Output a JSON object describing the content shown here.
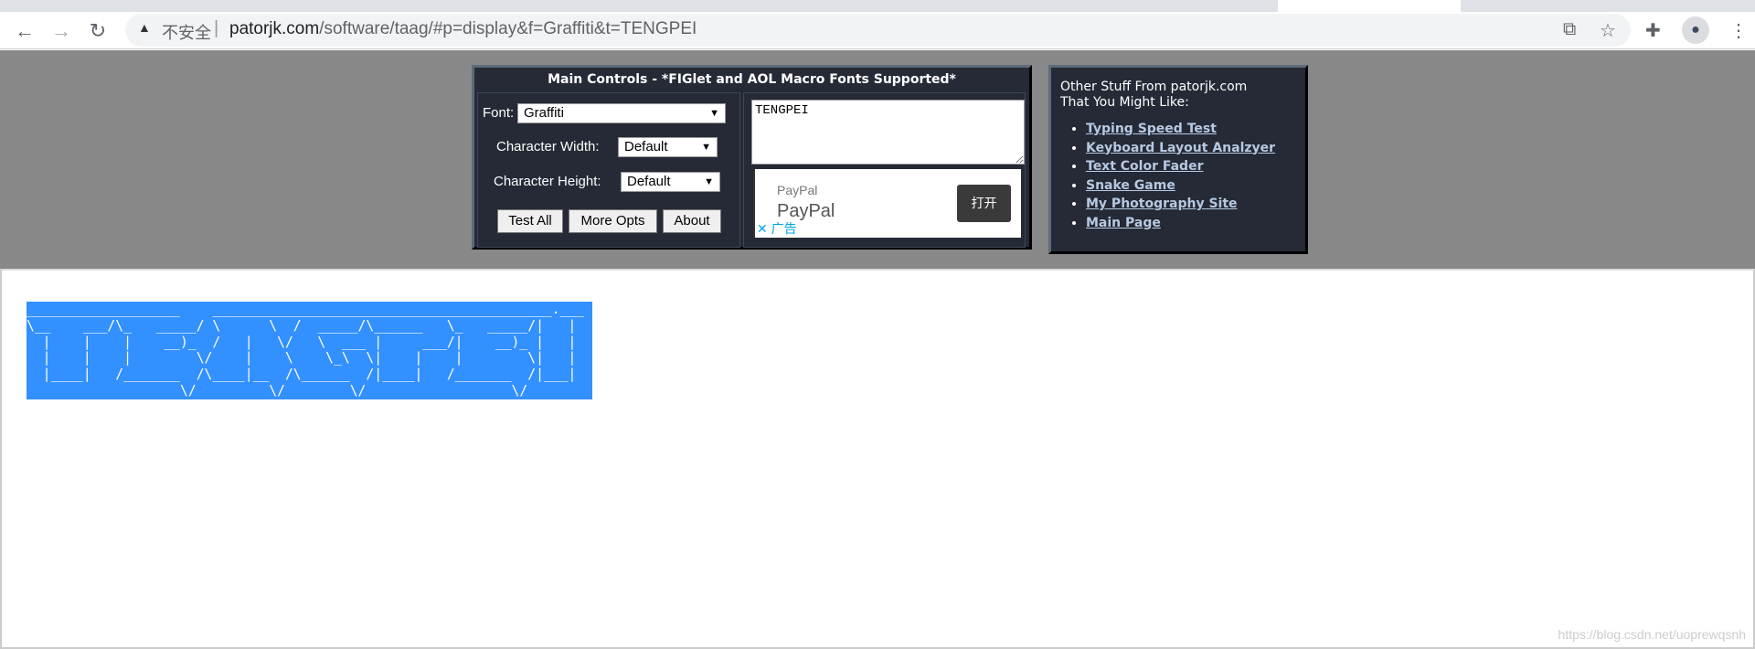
{
  "browser": {
    "security_icon": "warning-triangle-icon",
    "insecure_label": "不安全",
    "url_domain": "patorjk.com",
    "url_path": "/software/taag/#p=display&f=Graffiti&t=TENGPEI",
    "icons": [
      "back-arrow-icon",
      "forward-arrow-icon",
      "reload-icon",
      "translate-icon",
      "star-icon",
      "puzzle-extension-icon",
      "profile-icon",
      "kebab-menu-icon"
    ]
  },
  "main_controls": {
    "title": "Main Controls - *FIGlet and AOL Macro Fonts Supported*",
    "font_label": "Font:",
    "font_value": "Graffiti",
    "width_label": "Character Width:",
    "width_value": "Default",
    "height_label": "Character Height:",
    "height_value": "Default",
    "buttons": [
      "Test All",
      "More Opts",
      "About"
    ],
    "text_input": "TENGPEI",
    "ad": {
      "small": "PayPal",
      "big": "PayPal",
      "open_button": "打开",
      "ad_label": "✕ 广告"
    }
  },
  "other_stuff": {
    "heading_line1": "Other Stuff From patorjk.com",
    "heading_line2": "That You Might Like:",
    "links": [
      "Typing Speed Test",
      "Keyboard Layout Analzyer",
      "Text Color Fader",
      "Snake Game",
      "My Photography Site",
      "Main Page"
    ]
  },
  "output": {
    "ascii_art": "___________________    __________________________________________.___ \n\\__    ___/\\_   _____/ \\      \\  /  _____/\\______   \\_   _____/|   |\n  |    |    |    __)_  /   |   \\/   \\  ___ |     ___/|    __)_ |   |\n  |    |    |        \\/    |    \\    \\_\\  \\|    |    |        \\|   |\n  |____|   /_______  /\\____|__  /\\______  /|____|   /_______  /|___|\n                   \\/         \\/        \\/                  \\/      "
  },
  "watermark": "https://blog.csdn.net/uoprewqsnh",
  "colors": {
    "panel": "#252a36",
    "gray_bg": "#888888",
    "selection": "#3390ff",
    "link": "#b7c9e2"
  }
}
